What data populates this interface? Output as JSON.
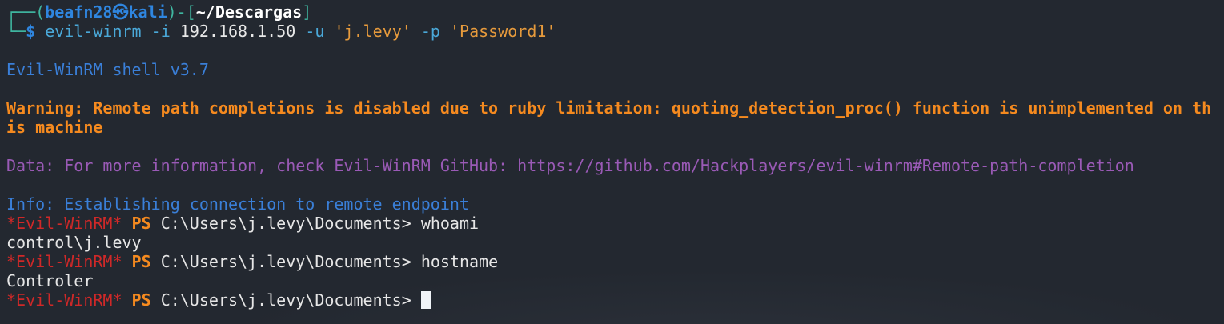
{
  "prompt": {
    "frame_top": "┌──(",
    "user": "beafn28",
    "skull": "㉿",
    "host": "kali",
    "mid": ")-[",
    "dir": "~/Descargas",
    "end": "]",
    "frame_bottom": "└─",
    "dollar": "$"
  },
  "command": {
    "name": "evil-winrm",
    "f1": "-i",
    "ip": "192.168.1.50",
    "f2": "-u",
    "user": "'j.levy'",
    "f3": "-p",
    "pass": "'Password1'"
  },
  "output": {
    "version": "Evil-WinRM shell v3.7",
    "warning": "Warning: Remote path completions is disabled due to ruby limitation: quoting_detection_proc() function is unimplemented on this machine",
    "data": "Data: For more information, check Evil-WinRM GitHub: https://github.com/Hackplayers/evil-winrm#Remote-path-completion",
    "info": "Info: Establishing connection to remote endpoint"
  },
  "session": {
    "tag": "*Evil-WinRM*",
    "ps": "PS",
    "path": "C:\\Users\\j.levy\\Documents>",
    "entries": [
      {
        "cmd": "whoami",
        "result": "control\\j.levy"
      },
      {
        "cmd": "hostname",
        "result": "Controler"
      }
    ]
  },
  "colors": {
    "background": "#232830",
    "warning": "#f58a1f",
    "data": "#9a5ab6",
    "info": "#3a7fd8",
    "tag": "#d02828"
  }
}
